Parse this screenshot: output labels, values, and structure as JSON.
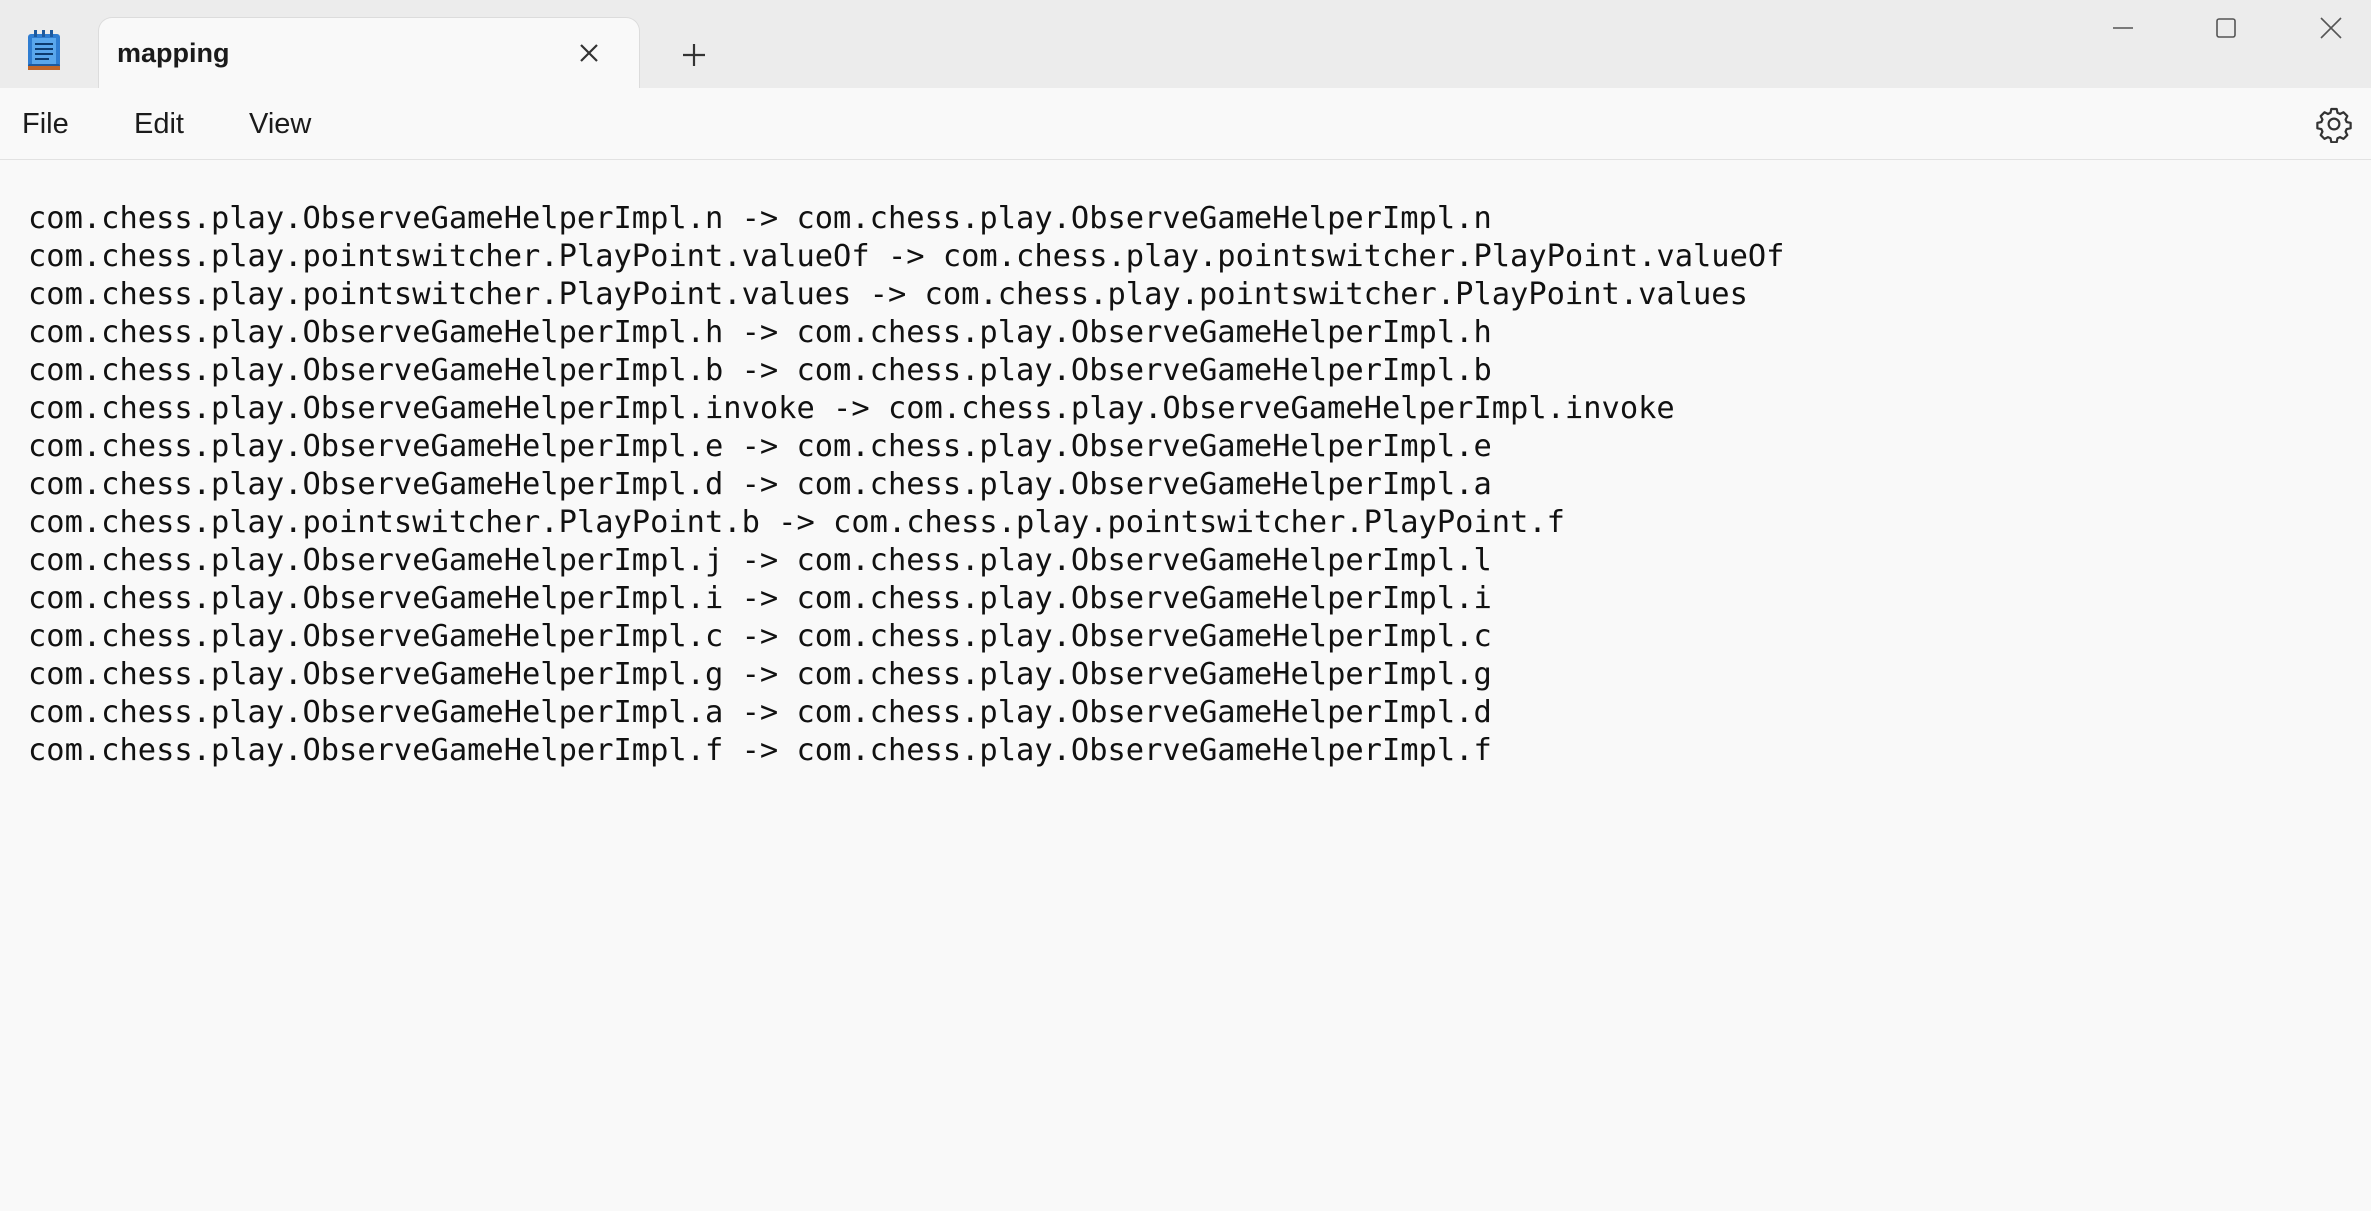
{
  "window": {
    "tab_title": "mapping",
    "icons": {
      "app": "notepad-icon",
      "tab_close": "close-icon",
      "new_tab": "plus-icon",
      "minimize": "minimize-icon",
      "maximize": "maximize-icon",
      "close": "close-icon"
    }
  },
  "menu": {
    "file": "File",
    "edit": "Edit",
    "view": "View",
    "settings_icon": "gear-icon"
  },
  "editor": {
    "lines": [
      "com.chess.play.ObserveGameHelperImpl.n -> com.chess.play.ObserveGameHelperImpl.n",
      "com.chess.play.pointswitcher.PlayPoint.valueOf -> com.chess.play.pointswitcher.PlayPoint.valueOf",
      "com.chess.play.pointswitcher.PlayPoint.values -> com.chess.play.pointswitcher.PlayPoint.values",
      "com.chess.play.ObserveGameHelperImpl.h -> com.chess.play.ObserveGameHelperImpl.h",
      "com.chess.play.ObserveGameHelperImpl.b -> com.chess.play.ObserveGameHelperImpl.b",
      "com.chess.play.ObserveGameHelperImpl.invoke -> com.chess.play.ObserveGameHelperImpl.invoke",
      "com.chess.play.ObserveGameHelperImpl.e -> com.chess.play.ObserveGameHelperImpl.e",
      "com.chess.play.ObserveGameHelperImpl.d -> com.chess.play.ObserveGameHelperImpl.a",
      "com.chess.play.pointswitcher.PlayPoint.b -> com.chess.play.pointswitcher.PlayPoint.f",
      "com.chess.play.ObserveGameHelperImpl.j -> com.chess.play.ObserveGameHelperImpl.l",
      "com.chess.play.ObserveGameHelperImpl.i -> com.chess.play.ObserveGameHelperImpl.i",
      "com.chess.play.ObserveGameHelperImpl.c -> com.chess.play.ObserveGameHelperImpl.c",
      "com.chess.play.ObserveGameHelperImpl.g -> com.chess.play.ObserveGameHelperImpl.g",
      "com.chess.play.ObserveGameHelperImpl.a -> com.chess.play.ObserveGameHelperImpl.d",
      "com.chess.play.ObserveGameHelperImpl.f -> com.chess.play.ObserveGameHelperImpl.f"
    ]
  }
}
